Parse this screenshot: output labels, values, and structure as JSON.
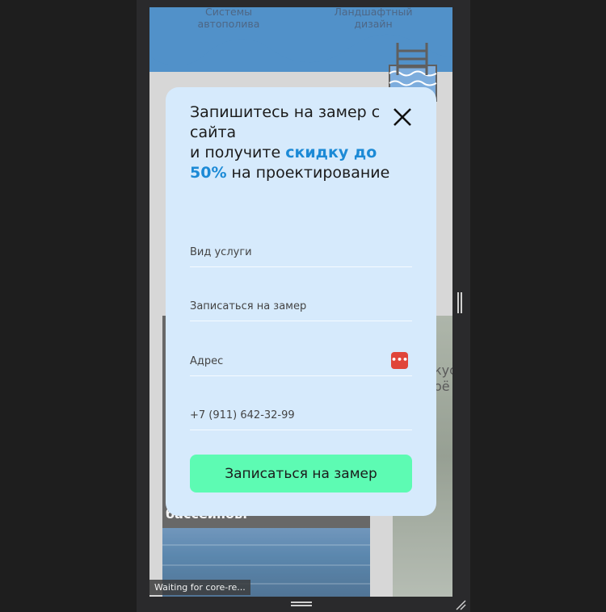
{
  "site": {
    "nav": [
      {
        "label": "Системы автополива"
      },
      {
        "label": "Ландшафтный дизайн"
      }
    ],
    "card_left_text": "бассейнов.",
    "card_right_text": "кус\nоё",
    "header_color": "#0e67b4"
  },
  "modal": {
    "title_line1": "Запишитесь на замер с сайта",
    "title_line2_prefix": "и получите ",
    "title_accent": "скидку до 50%",
    "title_line2_suffix": " на проектирование",
    "accent_color": "#1c8ad6",
    "close_icon": "close-icon",
    "fields": [
      {
        "placeholder": "Вид услуги"
      },
      {
        "placeholder": "Записаться на замер"
      },
      {
        "placeholder": "Адрес"
      },
      {
        "placeholder": "+7 (911) 642-32-99"
      }
    ],
    "autofill_icon": "password-manager-icon",
    "submit_label": "Записаться на замер",
    "submit_color": "#5dfbb3"
  },
  "status_bar": {
    "text": "Waiting for core-re..."
  }
}
